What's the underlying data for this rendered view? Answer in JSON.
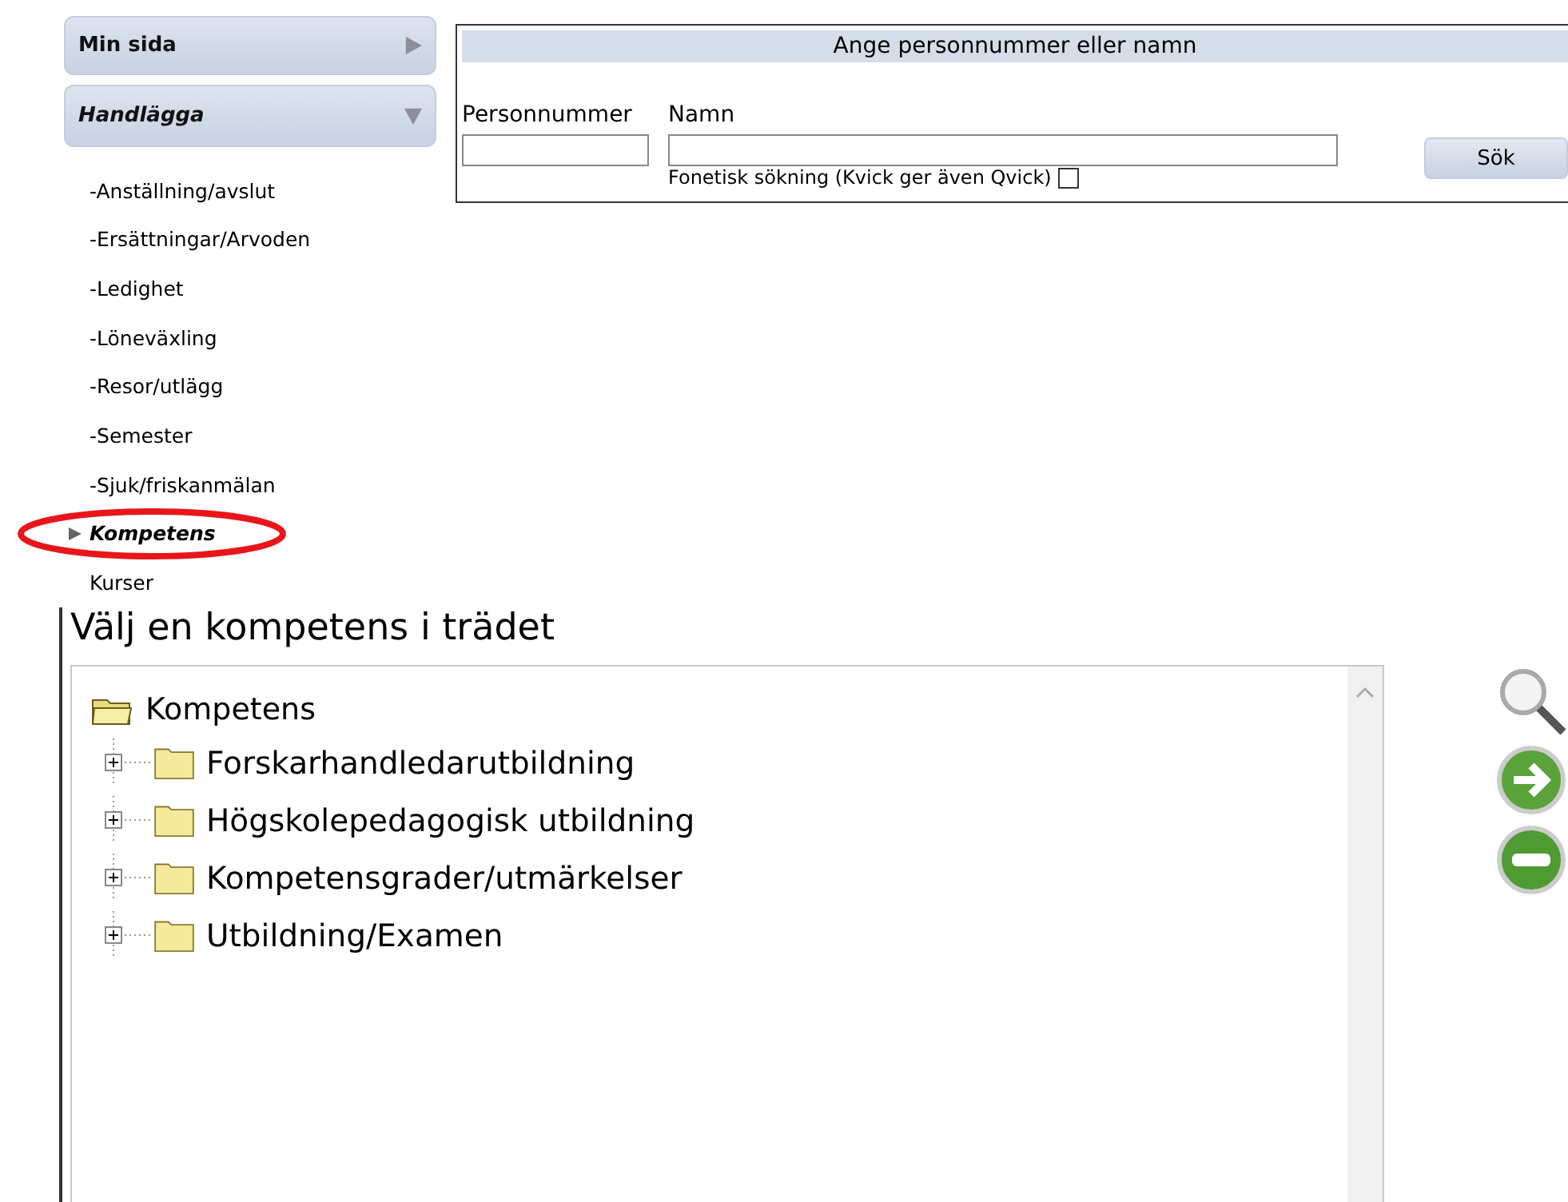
{
  "sidebar": {
    "sections": [
      {
        "label": "Min sida",
        "expanded": false
      },
      {
        "label": "Handlägga",
        "expanded": true
      }
    ],
    "items": [
      {
        "label": "-Anställning/avslut",
        "selected": false,
        "circled": false
      },
      {
        "label": "-Ersättningar/Arvoden",
        "selected": false,
        "circled": false
      },
      {
        "label": "-Ledighet",
        "selected": false,
        "circled": false
      },
      {
        "label": "-Löneväxling",
        "selected": false,
        "circled": false
      },
      {
        "label": "-Resor/utlägg",
        "selected": false,
        "circled": false
      },
      {
        "label": "-Semester",
        "selected": false,
        "circled": false
      },
      {
        "label": "-Sjuk/friskanmälan",
        "selected": false,
        "circled": false
      },
      {
        "label": "Kompetens",
        "selected": true,
        "circled": true
      },
      {
        "label": "Kurser",
        "selected": false,
        "circled": false
      }
    ]
  },
  "search": {
    "title": "Ange personnummer eller namn",
    "personnummer_label": "Personnummer",
    "name_label": "Namn",
    "phonetic_label": "Fonetisk sökning (Kvick ger även Qvick)",
    "phonetic_checked": false,
    "button": "Sök"
  },
  "tree": {
    "heading": "Välj en kompetens i trädet",
    "root": "Kompetens",
    "children": [
      {
        "label": "Forskarhandledarutbildning",
        "expanded": false
      },
      {
        "label": "Högskolepedagogisk utbildning",
        "expanded": false
      },
      {
        "label": "Kompetensgrader/utmärkelser",
        "expanded": false
      },
      {
        "label": "Utbildning/Examen",
        "expanded": false
      }
    ]
  }
}
